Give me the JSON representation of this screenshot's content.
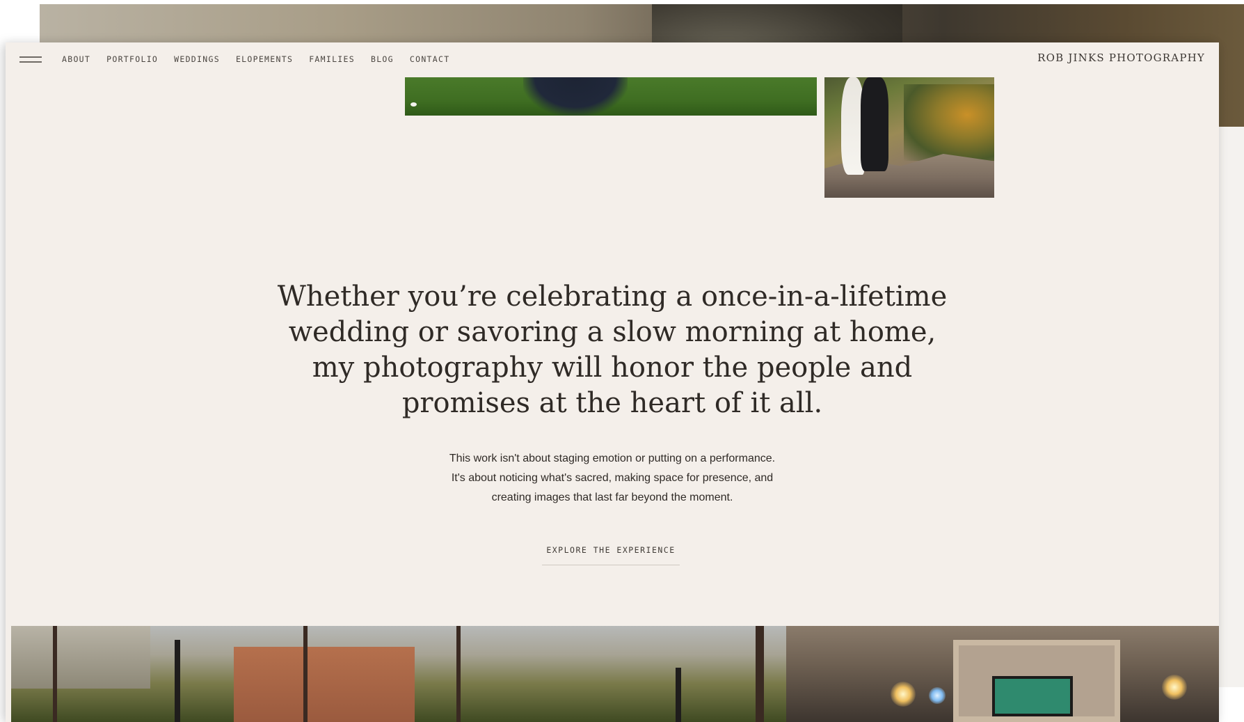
{
  "nav": {
    "items": [
      "ABOUT",
      "PORTFOLIO",
      "WEDDINGS",
      "ELOPEMENTS",
      "FAMILIES",
      "BLOG",
      "CONTACT"
    ],
    "brand": "ROB JINKS PHOTOGRAPHY",
    "menu_icon": "hamburger-menu-icon"
  },
  "hero": {
    "heading_lines": [
      "Whether you’re celebrating a once-in-a-lifetime",
      "wedding or savoring a slow morning at home,",
      "my photography will honor the people and",
      "promises at the heart of it all."
    ],
    "subtext_lines": [
      "This work isn't about staging emotion or putting on a performance.",
      "It's about noticing what's sacred, making space for presence, and",
      "creating images that last far beyond the moment."
    ],
    "cta_label": "EXPLORE THE EXPERIENCE"
  },
  "colors": {
    "page_background": "#f4efea",
    "text": "#2f2a26",
    "nav_text": "#4a4540",
    "underline": "#cfc9c2"
  }
}
